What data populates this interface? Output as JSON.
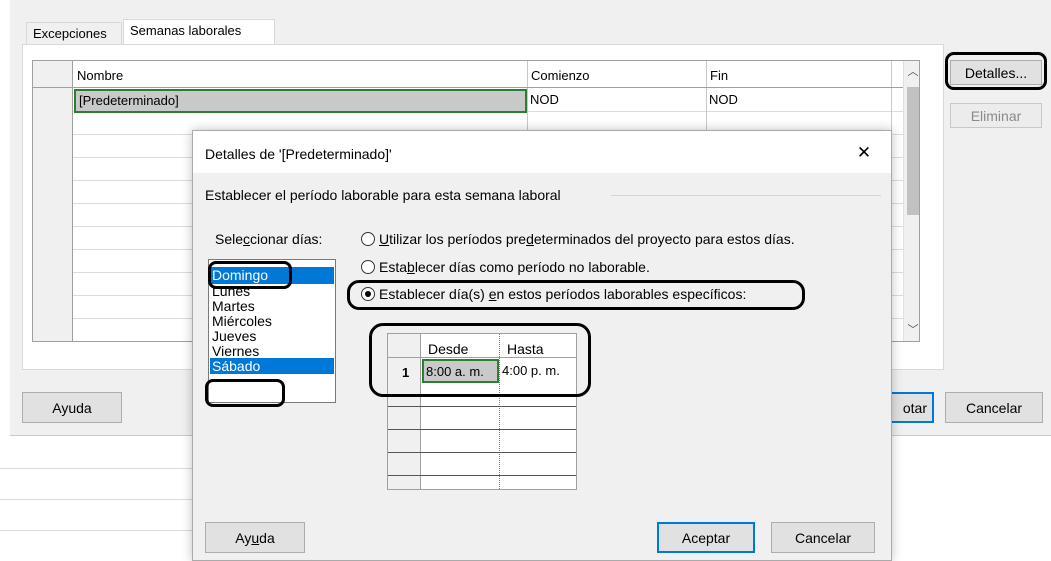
{
  "parent": {
    "tabs": [
      {
        "label": "Excepciones"
      },
      {
        "label": "Semanas laborales"
      }
    ],
    "table": {
      "headers": {
        "nombre": "Nombre",
        "comienzo": "Comienzo",
        "fin": "Fin"
      },
      "row1": {
        "nombre": "[Predeterminado]",
        "comienzo": "NOD",
        "fin": "NOD"
      }
    },
    "buttons": {
      "detalles": "Detalles...",
      "eliminar": "Eliminar",
      "ayuda": "Ayuda",
      "aceptar_partial": "otar",
      "cancelar": "Cancelar"
    }
  },
  "dialog": {
    "title": "Detalles de '[Predeterminado]'",
    "close": "✕",
    "section_label": "Establecer el período laborable para esta semana laboral",
    "select_days_label": "Seleccionar días:",
    "days": [
      "Domingo",
      "Lunes",
      "Martes",
      "Miércoles",
      "Jueves",
      "Viernes",
      "Sábado"
    ],
    "options": {
      "opt1": "Utilizar los períodos predeterminados del proyecto para estos días.",
      "opt2": "Establecer días como período no laborable.",
      "opt3": "Establecer día(s) en estos períodos laborables específicos:"
    },
    "time_table": {
      "header_desde": "Desde",
      "header_hasta": "Hasta",
      "row1_num": "1",
      "row1_desde": "8:00 a. m.",
      "row1_hasta": "4:00 p. m."
    },
    "buttons": {
      "ayuda": "Ayuda",
      "aceptar": "Aceptar",
      "cancelar": "Cancelar"
    }
  },
  "colors": {
    "selection": "#0078d7",
    "green_focus": "#2e7d32",
    "dialog_bg": "#f0f0f0"
  }
}
